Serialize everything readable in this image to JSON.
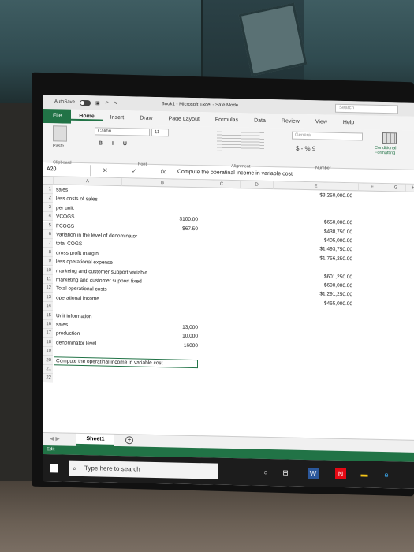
{
  "titlebar": {
    "autosave_label": "AutoSave",
    "autosave_state": "Off",
    "title": "Book1 - Microsoft Excel - Safe Mode",
    "search_placeholder": "Search"
  },
  "ribbon_tabs": [
    "File",
    "Home",
    "Insert",
    "Draw",
    "Page Layout",
    "Formulas",
    "Data",
    "Review",
    "View",
    "Help"
  ],
  "ribbon": {
    "paste_label": "Paste",
    "font_name": "Calibri",
    "font_size": "11",
    "biu": "B I U",
    "number_format": "General",
    "currency_symbol": "$ - % 9",
    "conditional_label": "Conditional Formatting",
    "groups": [
      "Clipboard",
      "Font",
      "Alignment",
      "Number"
    ]
  },
  "formula_bar": {
    "name_box": "A20",
    "formula": "Compute the operatinal income in variable cost"
  },
  "columns": [
    "A",
    "B",
    "C",
    "D",
    "E",
    "F",
    "G",
    "H"
  ],
  "rows": [
    {
      "n": "1",
      "a": "sales",
      "b": "",
      "e": "$3,250,000.00"
    },
    {
      "n": "2",
      "a": "less costs of sales",
      "b": "",
      "e": ""
    },
    {
      "n": "3",
      "a": "per unit:",
      "b": "",
      "e": ""
    },
    {
      "n": "4",
      "a": "VCOGS",
      "b": "$100.00",
      "e": "$650,000.00"
    },
    {
      "n": "5",
      "a": "FCOGS",
      "b": "$67.50",
      "e": "$438,750.00"
    },
    {
      "n": "6",
      "a": "Variation in the level of denominator",
      "b": "",
      "e": "$405,000.00"
    },
    {
      "n": "7",
      "a": "total COGS",
      "b": "",
      "e": "$1,493,750.00"
    },
    {
      "n": "8",
      "a": "gross profit margin",
      "b": "",
      "e": "$1,756,250.00"
    },
    {
      "n": "9",
      "a": "less operational expense",
      "b": "",
      "e": ""
    },
    {
      "n": "10",
      "a": "markeing and customer support variable",
      "b": "",
      "e": "$601,250.00"
    },
    {
      "n": "11",
      "a": "marketing and customer support fixed",
      "b": "",
      "e": "$690,000.00"
    },
    {
      "n": "12",
      "a": "Total operational costs",
      "b": "",
      "e": "$1,291,250.00"
    },
    {
      "n": "13",
      "a": "operational income",
      "b": "",
      "e": "$465,000.00"
    },
    {
      "n": "14",
      "a": "",
      "b": "",
      "e": ""
    },
    {
      "n": "15",
      "a": "Unit information",
      "b": "",
      "e": ""
    },
    {
      "n": "16",
      "a": "sales",
      "b": "13,000",
      "e": ""
    },
    {
      "n": "17",
      "a": "production",
      "b": "10,000",
      "e": ""
    },
    {
      "n": "18",
      "a": "denominator level",
      "b": "16000",
      "e": ""
    },
    {
      "n": "19",
      "a": "",
      "b": "",
      "e": ""
    },
    {
      "n": "20",
      "a": "Compute the operatinal income in variable cost",
      "b": "",
      "e": ""
    },
    {
      "n": "21",
      "a": "",
      "b": "",
      "e": ""
    },
    {
      "n": "22",
      "a": "",
      "b": "",
      "e": ""
    }
  ],
  "sheet_tab": "Sheet1",
  "status": "Edit",
  "taskbar": {
    "search_placeholder": "Type here to search"
  },
  "colors": {
    "excel_green": "#217346"
  }
}
